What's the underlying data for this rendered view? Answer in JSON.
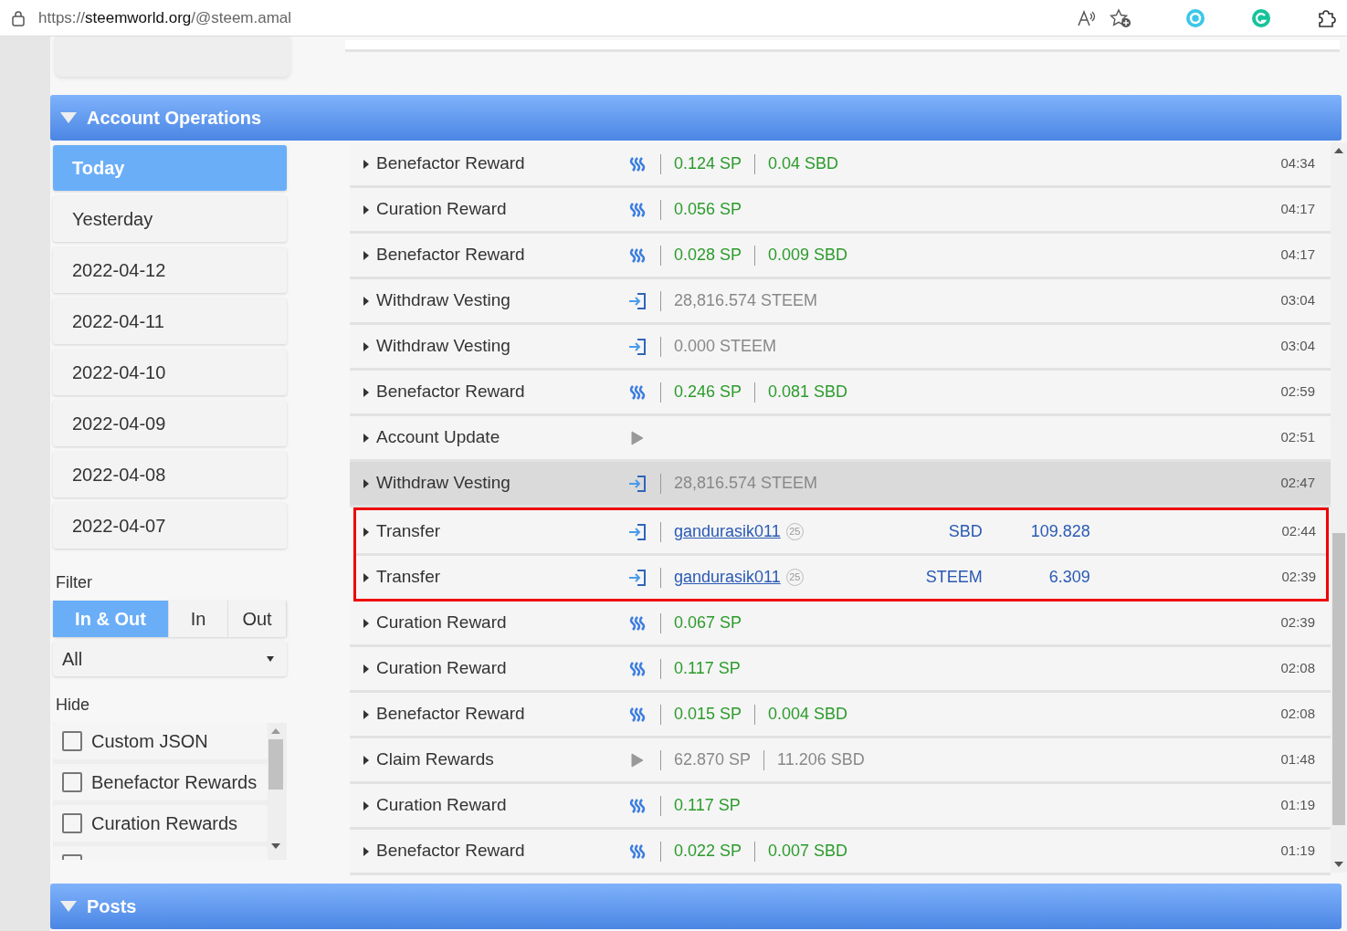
{
  "browser": {
    "url_scheme": "https://",
    "url_host": "steemworld.org",
    "url_path": "/@steem.amal"
  },
  "section": {
    "title": "Account Operations",
    "expanded": true
  },
  "days": [
    {
      "label": "Today",
      "selected": true
    },
    {
      "label": "Yesterday",
      "selected": false
    },
    {
      "label": "2022-04-12",
      "selected": false
    },
    {
      "label": "2022-04-11",
      "selected": false
    },
    {
      "label": "2022-04-10",
      "selected": false
    },
    {
      "label": "2022-04-09",
      "selected": false
    },
    {
      "label": "2022-04-08",
      "selected": false
    },
    {
      "label": "2022-04-07",
      "selected": false
    }
  ],
  "filter": {
    "label": "Filter",
    "directions": [
      {
        "label": "In & Out",
        "selected": true
      },
      {
        "label": "In",
        "selected": false
      },
      {
        "label": "Out",
        "selected": false
      }
    ],
    "type_value": "All"
  },
  "hide": {
    "label": "Hide",
    "options": [
      {
        "label": "Custom JSON",
        "checked": false
      },
      {
        "label": "Benefactor Rewards",
        "checked": false
      },
      {
        "label": "Curation Rewards",
        "checked": false
      },
      {
        "checked": false
      }
    ]
  },
  "operations": [
    {
      "kind": "reward",
      "title": "Benefactor Reward",
      "values": [
        "0.124 SP",
        "0.04 SBD"
      ],
      "time": "04:34",
      "hovered": false,
      "outlined": false
    },
    {
      "kind": "reward",
      "title": "Curation Reward",
      "values": [
        "0.056 SP"
      ],
      "time": "04:17",
      "hovered": false,
      "outlined": false
    },
    {
      "kind": "reward",
      "title": "Benefactor Reward",
      "values": [
        "0.028 SP",
        "0.009 SBD"
      ],
      "time": "04:17",
      "hovered": false,
      "outlined": false
    },
    {
      "kind": "vesting",
      "title": "Withdraw Vesting",
      "values": [
        "28,816.574 STEEM"
      ],
      "time": "03:04",
      "hovered": false,
      "outlined": false
    },
    {
      "kind": "vesting",
      "title": "Withdraw Vesting",
      "values": [
        "0.000 STEEM"
      ],
      "time": "03:04",
      "hovered": false,
      "outlined": false
    },
    {
      "kind": "reward",
      "title": "Benefactor Reward",
      "values": [
        "0.246 SP",
        "0.081 SBD"
      ],
      "time": "02:59",
      "hovered": false,
      "outlined": false
    },
    {
      "kind": "update",
      "title": "Account Update",
      "time": "02:51",
      "hovered": false,
      "outlined": false
    },
    {
      "kind": "vesting",
      "title": "Withdraw Vesting",
      "values": [
        "28,816.574 STEEM"
      ],
      "time": "02:47",
      "hovered": true,
      "outlined": false
    },
    {
      "kind": "transfer",
      "title": "Transfer",
      "account": "gandurasik011",
      "reputation": "25",
      "currency": "SBD",
      "amount": "109.828",
      "time": "02:44",
      "hovered": false,
      "outlined": true
    },
    {
      "kind": "transfer",
      "title": "Transfer",
      "account": "gandurasik011",
      "reputation": "25",
      "currency": "STEEM",
      "amount": "6.309",
      "time": "02:39",
      "hovered": false,
      "outlined": true
    },
    {
      "kind": "reward",
      "title": "Curation Reward",
      "values": [
        "0.067 SP"
      ],
      "time": "02:39",
      "hovered": false,
      "outlined": false
    },
    {
      "kind": "reward",
      "title": "Curation Reward",
      "values": [
        "0.117 SP"
      ],
      "time": "02:08",
      "hovered": false,
      "outlined": false
    },
    {
      "kind": "reward",
      "title": "Benefactor Reward",
      "values": [
        "0.015 SP",
        "0.004 SBD"
      ],
      "time": "02:08",
      "hovered": false,
      "outlined": false
    },
    {
      "kind": "claim",
      "title": "Claim Rewards",
      "values": [
        "62.870 SP",
        "11.206 SBD"
      ],
      "time": "01:48",
      "hovered": false,
      "outlined": false
    },
    {
      "kind": "reward",
      "title": "Curation Reward",
      "values": [
        "0.117 SP"
      ],
      "time": "01:19",
      "hovered": false,
      "outlined": false
    },
    {
      "kind": "reward",
      "title": "Benefactor Reward",
      "values": [
        "0.022 SP",
        "0.007 SBD"
      ],
      "time": "01:19",
      "hovered": false,
      "outlined": false
    }
  ],
  "next_section": {
    "title": "Posts",
    "expanded": true
  }
}
